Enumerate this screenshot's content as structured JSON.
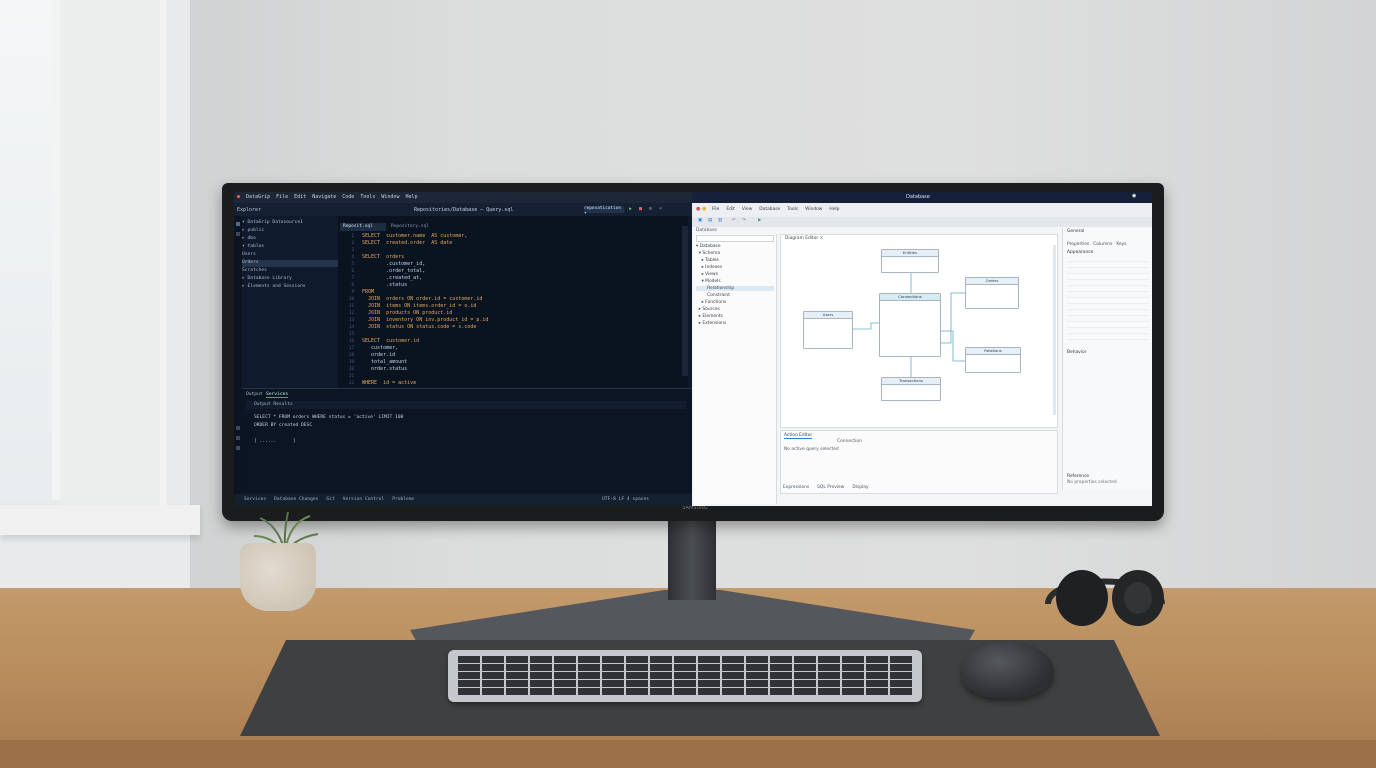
{
  "scene": {
    "description_colors": {
      "wall": "#dcdddd",
      "desk": "#b98d5e",
      "mat": "#3f4041",
      "ide_bg": "#0e1a2a",
      "app_bg": "#f4f5f7",
      "accent": "#2a7fd4"
    }
  },
  "monitor": {
    "brand": "SAMSUNG"
  },
  "ide": {
    "menu": [
      "DataGrip",
      "File",
      "Edit",
      "Navigate",
      "Code",
      "Tools",
      "Window",
      "Help"
    ],
    "window_title": "Repositories/Database – Query.sql",
    "editor_tab": "Reposit.sql",
    "editor_tab2": "Repository.sql",
    "config_label": "reposatication ▾",
    "tree_title": "Explorer",
    "tree": [
      "▾ DataGrip  Datasource1",
      "  ▸ public",
      "  ▸ dbo",
      "  ▾ tables",
      "      Users",
      "      Orders",
      "    Scratches",
      "  ▸ Database Library",
      "  ▸ Elements and Sessions"
    ],
    "code": [
      "SELECT  customer.name  AS customer,",
      "SELECT  created.order  AS date",
      "",
      "SELECT  orders",
      "        .customer_id,",
      "        .order_total,",
      "        .created_at,",
      "        .status",
      "FROM",
      "  JOIN  orders ON order.id = customer.id",
      "  JOIN  items ON items.order_id = o.id",
      "  JOIN  products ON product.id",
      "  JOIN  inventory ON inv.product_id = p.id",
      "  JOIN  status ON status.code = s.code",
      "",
      "SELECT  customer.id",
      "   customer,",
      "   order.id",
      "   total_amount",
      "   order.status",
      "",
      "WHERE  id = active"
    ],
    "bottom_tabs": [
      "Output",
      "Services"
    ],
    "bottom_toolbar": "Output   Results",
    "output": [
      "SELECT * FROM orders WHERE status = 'active' LIMIT 100",
      "ORDER BY created DESC",
      "",
      "[ ......      ]"
    ],
    "status_items": [
      "Services",
      "Database Changes",
      "Git",
      "Version Control",
      "Problems"
    ],
    "status_right": "UTF-8  LF  4 spaces"
  },
  "app": {
    "title": "Database",
    "menu": [
      "File",
      "Edit",
      "View",
      "Database",
      "Tools",
      "Window",
      "Help"
    ],
    "tree_header": "Database",
    "tree": [
      "▾ Database",
      "  ▾ Schema",
      "    ▸ Tables",
      "    ▸ Indexes",
      "    ▸ Views",
      "    ▾ Models",
      "        Relationship",
      "        Constraint",
      "    ▸ Functions",
      "  ▸ Sources",
      "  ▸ Elements",
      "  ▸ Extensions"
    ],
    "canvas_tab": "Diagram Editor ×",
    "entities": {
      "top": "Entities",
      "left": "Users",
      "center": "Connections",
      "right_top": "Orders",
      "right_bottom": "Relations",
      "bottom": "Transactions"
    },
    "bottom_panel_tab": "Action Editor",
    "bottom_panel_tab2": "Connection",
    "bottom_panel_text": "No active query selected",
    "bottom_tabs": [
      "Expressions",
      "SQL Preview",
      "Display"
    ],
    "props_title": "General",
    "props_tabs": [
      "Properties",
      "Columns",
      "Keys"
    ],
    "props_section": "Appearance",
    "props_section2": "Behavior",
    "props_footer": "Reference",
    "props_footer2": "No properties selected"
  }
}
